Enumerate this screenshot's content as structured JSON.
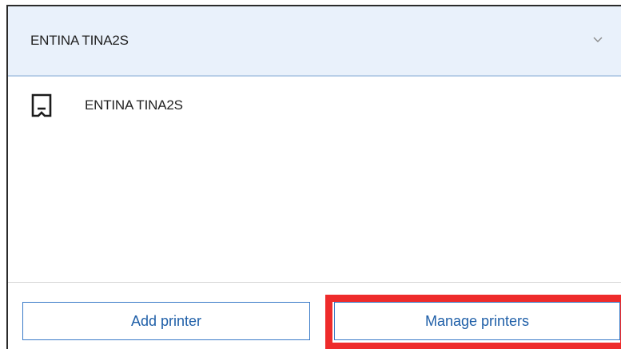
{
  "dropdown": {
    "selected_label": "ENTINA TINA2S",
    "chevron_icon": "chevron-down-icon"
  },
  "printers": [
    {
      "label": "ENTINA TINA2S",
      "icon": "printer-icon"
    }
  ],
  "buttons": {
    "add_label": "Add printer",
    "manage_label": "Manage printers"
  },
  "colors": {
    "header_bg": "#e9f1fb",
    "accent_blue": "#3a7bc8",
    "button_text": "#1f5fa8",
    "highlight_red": "#ee2b2b"
  }
}
